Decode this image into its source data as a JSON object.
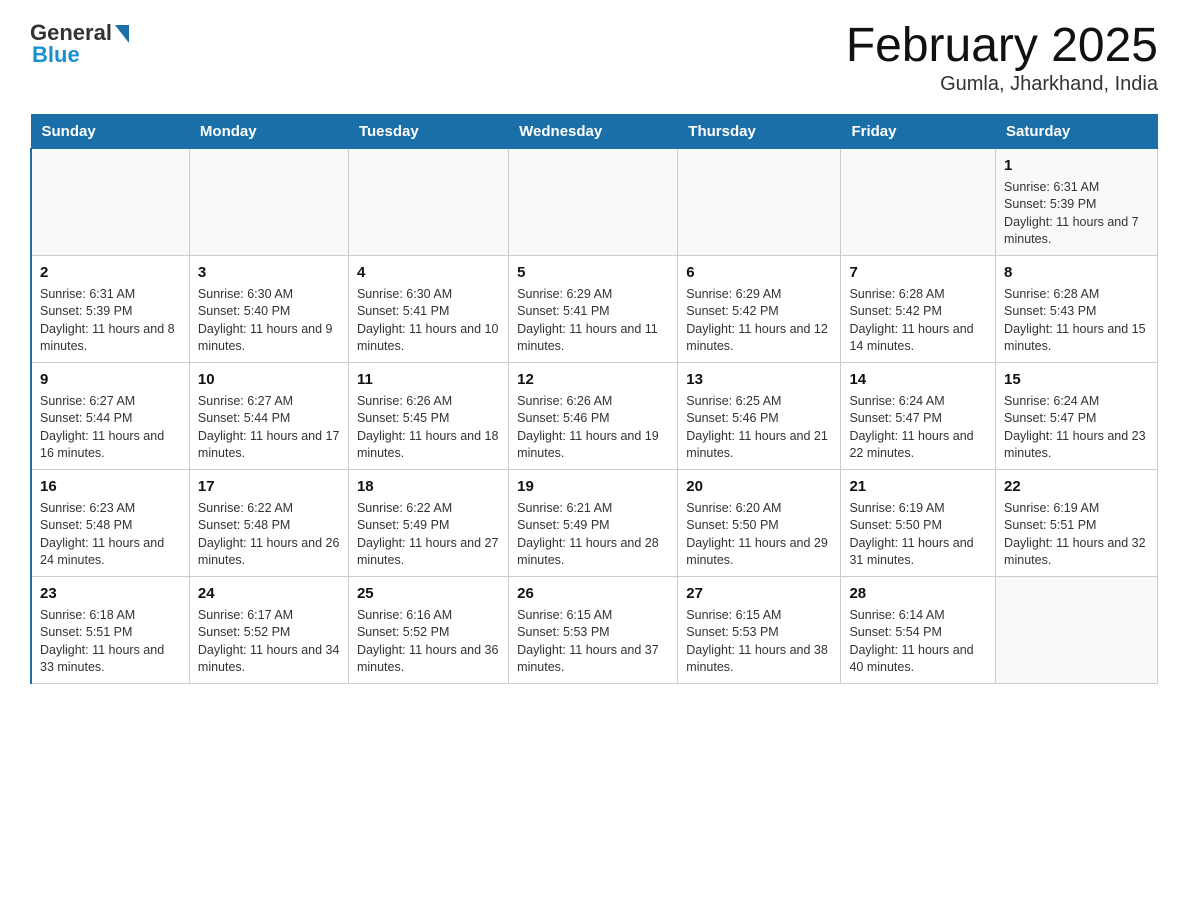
{
  "header": {
    "logo": {
      "general": "General",
      "blue": "Blue"
    },
    "title": "February 2025",
    "subtitle": "Gumla, Jharkhand, India"
  },
  "calendar": {
    "days_of_week": [
      "Sunday",
      "Monday",
      "Tuesday",
      "Wednesday",
      "Thursday",
      "Friday",
      "Saturday"
    ],
    "weeks": [
      {
        "days": [
          {
            "number": "",
            "sunrise": "",
            "sunset": "",
            "daylight": ""
          },
          {
            "number": "",
            "sunrise": "",
            "sunset": "",
            "daylight": ""
          },
          {
            "number": "",
            "sunrise": "",
            "sunset": "",
            "daylight": ""
          },
          {
            "number": "",
            "sunrise": "",
            "sunset": "",
            "daylight": ""
          },
          {
            "number": "",
            "sunrise": "",
            "sunset": "",
            "daylight": ""
          },
          {
            "number": "",
            "sunrise": "",
            "sunset": "",
            "daylight": ""
          },
          {
            "number": "1",
            "sunrise": "Sunrise: 6:31 AM",
            "sunset": "Sunset: 5:39 PM",
            "daylight": "Daylight: 11 hours and 7 minutes."
          }
        ]
      },
      {
        "days": [
          {
            "number": "2",
            "sunrise": "Sunrise: 6:31 AM",
            "sunset": "Sunset: 5:39 PM",
            "daylight": "Daylight: 11 hours and 8 minutes."
          },
          {
            "number": "3",
            "sunrise": "Sunrise: 6:30 AM",
            "sunset": "Sunset: 5:40 PM",
            "daylight": "Daylight: 11 hours and 9 minutes."
          },
          {
            "number": "4",
            "sunrise": "Sunrise: 6:30 AM",
            "sunset": "Sunset: 5:41 PM",
            "daylight": "Daylight: 11 hours and 10 minutes."
          },
          {
            "number": "5",
            "sunrise": "Sunrise: 6:29 AM",
            "sunset": "Sunset: 5:41 PM",
            "daylight": "Daylight: 11 hours and 11 minutes."
          },
          {
            "number": "6",
            "sunrise": "Sunrise: 6:29 AM",
            "sunset": "Sunset: 5:42 PM",
            "daylight": "Daylight: 11 hours and 12 minutes."
          },
          {
            "number": "7",
            "sunrise": "Sunrise: 6:28 AM",
            "sunset": "Sunset: 5:42 PM",
            "daylight": "Daylight: 11 hours and 14 minutes."
          },
          {
            "number": "8",
            "sunrise": "Sunrise: 6:28 AM",
            "sunset": "Sunset: 5:43 PM",
            "daylight": "Daylight: 11 hours and 15 minutes."
          }
        ]
      },
      {
        "days": [
          {
            "number": "9",
            "sunrise": "Sunrise: 6:27 AM",
            "sunset": "Sunset: 5:44 PM",
            "daylight": "Daylight: 11 hours and 16 minutes."
          },
          {
            "number": "10",
            "sunrise": "Sunrise: 6:27 AM",
            "sunset": "Sunset: 5:44 PM",
            "daylight": "Daylight: 11 hours and 17 minutes."
          },
          {
            "number": "11",
            "sunrise": "Sunrise: 6:26 AM",
            "sunset": "Sunset: 5:45 PM",
            "daylight": "Daylight: 11 hours and 18 minutes."
          },
          {
            "number": "12",
            "sunrise": "Sunrise: 6:26 AM",
            "sunset": "Sunset: 5:46 PM",
            "daylight": "Daylight: 11 hours and 19 minutes."
          },
          {
            "number": "13",
            "sunrise": "Sunrise: 6:25 AM",
            "sunset": "Sunset: 5:46 PM",
            "daylight": "Daylight: 11 hours and 21 minutes."
          },
          {
            "number": "14",
            "sunrise": "Sunrise: 6:24 AM",
            "sunset": "Sunset: 5:47 PM",
            "daylight": "Daylight: 11 hours and 22 minutes."
          },
          {
            "number": "15",
            "sunrise": "Sunrise: 6:24 AM",
            "sunset": "Sunset: 5:47 PM",
            "daylight": "Daylight: 11 hours and 23 minutes."
          }
        ]
      },
      {
        "days": [
          {
            "number": "16",
            "sunrise": "Sunrise: 6:23 AM",
            "sunset": "Sunset: 5:48 PM",
            "daylight": "Daylight: 11 hours and 24 minutes."
          },
          {
            "number": "17",
            "sunrise": "Sunrise: 6:22 AM",
            "sunset": "Sunset: 5:48 PM",
            "daylight": "Daylight: 11 hours and 26 minutes."
          },
          {
            "number": "18",
            "sunrise": "Sunrise: 6:22 AM",
            "sunset": "Sunset: 5:49 PM",
            "daylight": "Daylight: 11 hours and 27 minutes."
          },
          {
            "number": "19",
            "sunrise": "Sunrise: 6:21 AM",
            "sunset": "Sunset: 5:49 PM",
            "daylight": "Daylight: 11 hours and 28 minutes."
          },
          {
            "number": "20",
            "sunrise": "Sunrise: 6:20 AM",
            "sunset": "Sunset: 5:50 PM",
            "daylight": "Daylight: 11 hours and 29 minutes."
          },
          {
            "number": "21",
            "sunrise": "Sunrise: 6:19 AM",
            "sunset": "Sunset: 5:50 PM",
            "daylight": "Daylight: 11 hours and 31 minutes."
          },
          {
            "number": "22",
            "sunrise": "Sunrise: 6:19 AM",
            "sunset": "Sunset: 5:51 PM",
            "daylight": "Daylight: 11 hours and 32 minutes."
          }
        ]
      },
      {
        "days": [
          {
            "number": "23",
            "sunrise": "Sunrise: 6:18 AM",
            "sunset": "Sunset: 5:51 PM",
            "daylight": "Daylight: 11 hours and 33 minutes."
          },
          {
            "number": "24",
            "sunrise": "Sunrise: 6:17 AM",
            "sunset": "Sunset: 5:52 PM",
            "daylight": "Daylight: 11 hours and 34 minutes."
          },
          {
            "number": "25",
            "sunrise": "Sunrise: 6:16 AM",
            "sunset": "Sunset: 5:52 PM",
            "daylight": "Daylight: 11 hours and 36 minutes."
          },
          {
            "number": "26",
            "sunrise": "Sunrise: 6:15 AM",
            "sunset": "Sunset: 5:53 PM",
            "daylight": "Daylight: 11 hours and 37 minutes."
          },
          {
            "number": "27",
            "sunrise": "Sunrise: 6:15 AM",
            "sunset": "Sunset: 5:53 PM",
            "daylight": "Daylight: 11 hours and 38 minutes."
          },
          {
            "number": "28",
            "sunrise": "Sunrise: 6:14 AM",
            "sunset": "Sunset: 5:54 PM",
            "daylight": "Daylight: 11 hours and 40 minutes."
          },
          {
            "number": "",
            "sunrise": "",
            "sunset": "",
            "daylight": ""
          }
        ]
      }
    ]
  }
}
